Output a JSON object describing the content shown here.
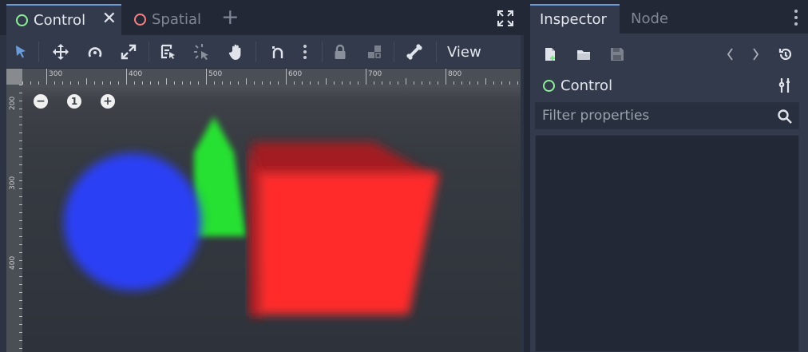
{
  "editor": {
    "tabs": [
      {
        "label": "Control",
        "type": "control",
        "active": true
      },
      {
        "label": "Spatial",
        "type": "spatial",
        "active": false
      }
    ],
    "close_glyph": "✕",
    "add_glyph": "+",
    "toolbar": {
      "tools": [
        "select-icon",
        "move-icon",
        "rotate-icon",
        "scale-icon",
        "list-select-icon",
        "pivot-icon",
        "pan-icon",
        "snap-icon",
        "more-icon",
        "lock-icon",
        "group-icon",
        "bone-icon"
      ],
      "view_label": "View"
    },
    "rulers": {
      "horizontal": [
        "300",
        "400",
        "500",
        "600",
        "700",
        "800"
      ],
      "vertical": [
        "200",
        "300",
        "400"
      ]
    },
    "zoom": {
      "out": "−",
      "reset": "1",
      "in": "+"
    },
    "shapes": {
      "circle_color": "#2b40f5",
      "triangle_color": "#26e032",
      "cube_front_color": "#ff2a2a",
      "cube_side_color": "#b81f21",
      "cube_top_color": "#a31c20"
    }
  },
  "inspector": {
    "tabs": [
      {
        "label": "Inspector",
        "active": true
      },
      {
        "label": "Node",
        "active": false
      }
    ],
    "node_name": "Control",
    "filter_placeholder": "Filter properties",
    "accent": "#6b9bd8"
  }
}
